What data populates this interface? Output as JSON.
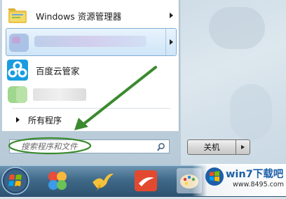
{
  "start_menu": {
    "items": [
      {
        "label": "Windows 资源管理器",
        "icon": "folder-icon",
        "has_submenu": true
      },
      {
        "label": "",
        "icon": "blurred-app-icon",
        "has_submenu": true,
        "highlighted": true
      },
      {
        "label": "百度云管家",
        "icon": "baidu-cloud-icon",
        "has_submenu": false
      },
      {
        "label": "",
        "icon": "blurred-app-icon",
        "has_submenu": false
      }
    ],
    "all_programs_label": "所有程序",
    "search": {
      "placeholder": "搜索程序和文件",
      "value": ""
    },
    "shutdown_label": "关机"
  },
  "taskbar": {
    "icons": [
      "start-orb-icon",
      "pinwheel-app-icon",
      "bird-app-icon",
      "red-app-icon",
      "paint-palette-icon"
    ]
  },
  "watermark": {
    "title": "win7下载吧",
    "url": "www.8495.com"
  },
  "colors": {
    "annotation": "#3b8a2f",
    "highlight_border": "#84aed6",
    "taskbar_blue": "#3f6988",
    "watermark_blue": "#1b5fa8"
  }
}
